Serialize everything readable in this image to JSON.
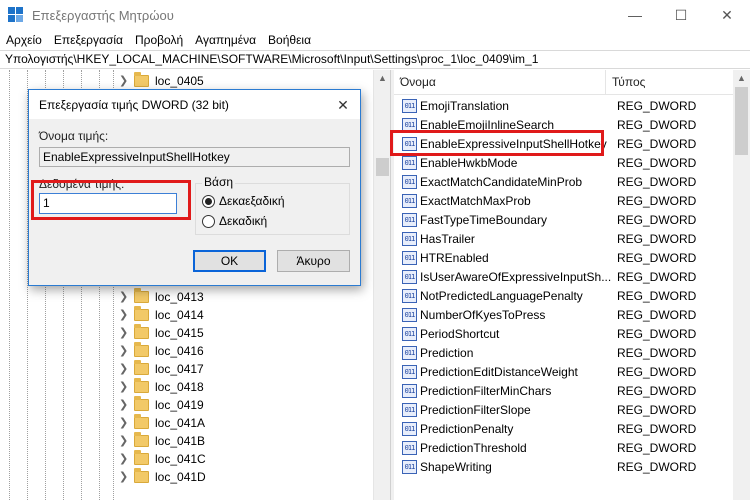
{
  "window": {
    "title": "Επεξεργαστής Μητρώου",
    "minimize": "—",
    "maximize": "☐",
    "close": "✕"
  },
  "menu": [
    "Αρχείο",
    "Επεξεργασία",
    "Προβολή",
    "Αγαπημένα",
    "Βοήθεια"
  ],
  "address": "Υπολογιστής\\HKEY_LOCAL_MACHINE\\SOFTWARE\\Microsoft\\Input\\Settings\\proc_1\\loc_0409\\im_1",
  "tree": {
    "items": [
      {
        "label": "loc_0405"
      },
      {
        "label": "loc_0413"
      },
      {
        "label": "loc_0414"
      },
      {
        "label": "loc_0415"
      },
      {
        "label": "loc_0416"
      },
      {
        "label": "loc_0417"
      },
      {
        "label": "loc_0418"
      },
      {
        "label": "loc_0419"
      },
      {
        "label": "loc_041A"
      },
      {
        "label": "loc_041B"
      },
      {
        "label": "loc_041C"
      },
      {
        "label": "loc_041D"
      }
    ]
  },
  "list": {
    "col_name": "Όνομα",
    "col_type": "Τύπος",
    "icon_text": "011",
    "rows": [
      {
        "name": "EmojiTranslation",
        "type": "REG_DWORD"
      },
      {
        "name": "EnableEmojiInlineSearch",
        "type": "REG_DWORD"
      },
      {
        "name": "EnableExpressiveInputShellHotkey",
        "type": "REG_DWORD"
      },
      {
        "name": "EnableHwkbMode",
        "type": "REG_DWORD"
      },
      {
        "name": "ExactMatchCandidateMinProb",
        "type": "REG_DWORD"
      },
      {
        "name": "ExactMatchMaxProb",
        "type": "REG_DWORD"
      },
      {
        "name": "FastTypeTimeBoundary",
        "type": "REG_DWORD"
      },
      {
        "name": "HasTrailer",
        "type": "REG_DWORD"
      },
      {
        "name": "HTREnabled",
        "type": "REG_DWORD"
      },
      {
        "name": "IsUserAwareOfExpressiveInputSh...",
        "type": "REG_DWORD"
      },
      {
        "name": "NotPredictedLanguagePenalty",
        "type": "REG_DWORD"
      },
      {
        "name": "NumberOfKyesToPress",
        "type": "REG_DWORD"
      },
      {
        "name": "PeriodShortcut",
        "type": "REG_DWORD"
      },
      {
        "name": "Prediction",
        "type": "REG_DWORD"
      },
      {
        "name": "PredictionEditDistanceWeight",
        "type": "REG_DWORD"
      },
      {
        "name": "PredictionFilterMinChars",
        "type": "REG_DWORD"
      },
      {
        "name": "PredictionFilterSlope",
        "type": "REG_DWORD"
      },
      {
        "name": "PredictionPenalty",
        "type": "REG_DWORD"
      },
      {
        "name": "PredictionThreshold",
        "type": "REG_DWORD"
      },
      {
        "name": "ShapeWriting",
        "type": "REG_DWORD"
      }
    ]
  },
  "dialog": {
    "title": "Επεξεργασία τιμής DWORD (32 bit)",
    "close": "✕",
    "value_name_label": "Όνομα τιμής:",
    "value_name": "EnableExpressiveInputShellHotkey",
    "value_data_label": "Δεδομένα τιμής:",
    "value_data": "1",
    "base_label": "Βάση",
    "hex_label": "Δεκαεξαδική",
    "dec_label": "Δεκαδική",
    "selected_base": "hex",
    "ok": "OK",
    "cancel": "Άκυρο"
  },
  "colors": {
    "highlight": "#e01a1a",
    "accent": "#0a64d8"
  }
}
